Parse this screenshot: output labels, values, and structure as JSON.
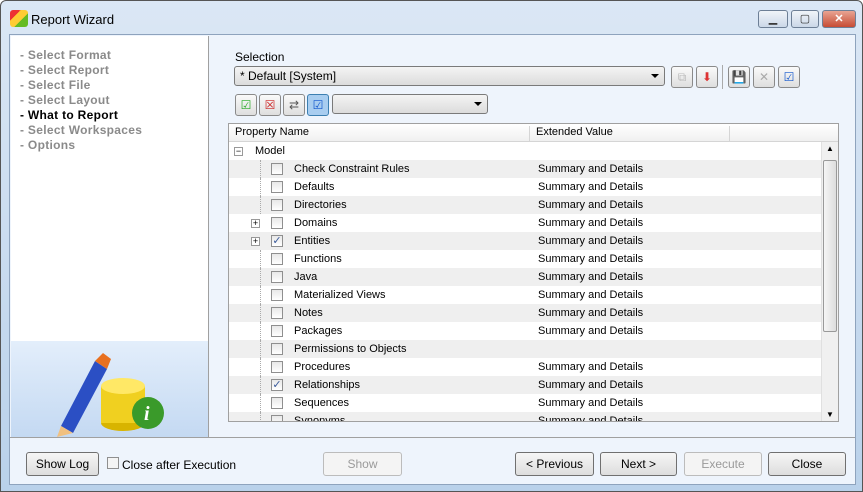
{
  "window": {
    "title": "Report Wizard"
  },
  "steps": [
    {
      "label": "- Select Format",
      "current": false
    },
    {
      "label": "- Select Report",
      "current": false
    },
    {
      "label": "- Select File",
      "current": false
    },
    {
      "label": "- Select Layout",
      "current": false
    },
    {
      "label": "- What to Report",
      "current": true
    },
    {
      "label": "- Select Workspaces",
      "current": false
    },
    {
      "label": "- Options",
      "current": false
    }
  ],
  "selection": {
    "label": "Selection",
    "value": "* Default [System]",
    "filter_value": ""
  },
  "grid": {
    "headers": [
      "Property Name",
      "Extended Value"
    ],
    "root": "Model",
    "rows": [
      {
        "name": "Check Constraint Rules",
        "value": "Summary and Details",
        "checked": false,
        "expandable": false
      },
      {
        "name": "Defaults",
        "value": "Summary and Details",
        "checked": false,
        "expandable": false
      },
      {
        "name": "Directories",
        "value": "Summary and Details",
        "checked": false,
        "expandable": false
      },
      {
        "name": "Domains",
        "value": "Summary and Details",
        "checked": false,
        "expandable": true
      },
      {
        "name": "Entities",
        "value": "Summary and Details",
        "checked": true,
        "expandable": true
      },
      {
        "name": "Functions",
        "value": "Summary and Details",
        "checked": false,
        "expandable": false
      },
      {
        "name": "Java",
        "value": "Summary and Details",
        "checked": false,
        "expandable": false
      },
      {
        "name": "Materialized Views",
        "value": "Summary and Details",
        "checked": false,
        "expandable": false
      },
      {
        "name": "Notes",
        "value": "Summary and Details",
        "checked": false,
        "expandable": false
      },
      {
        "name": "Packages",
        "value": "Summary and Details",
        "checked": false,
        "expandable": false
      },
      {
        "name": "Permissions to Objects",
        "value": "",
        "checked": false,
        "expandable": false
      },
      {
        "name": "Procedures",
        "value": "Summary and Details",
        "checked": false,
        "expandable": false
      },
      {
        "name": "Relationships",
        "value": "Summary and Details",
        "checked": true,
        "expandable": false
      },
      {
        "name": "Sequences",
        "value": "Summary and Details",
        "checked": false,
        "expandable": false
      },
      {
        "name": "Synonyms",
        "value": "Summary and Details",
        "checked": false,
        "expandable": false
      }
    ]
  },
  "footer": {
    "show_log": "Show Log",
    "close_after": "Close after Execution",
    "show": "Show",
    "previous": "< Previous",
    "next": "Next >",
    "execute": "Execute",
    "close": "Close"
  }
}
